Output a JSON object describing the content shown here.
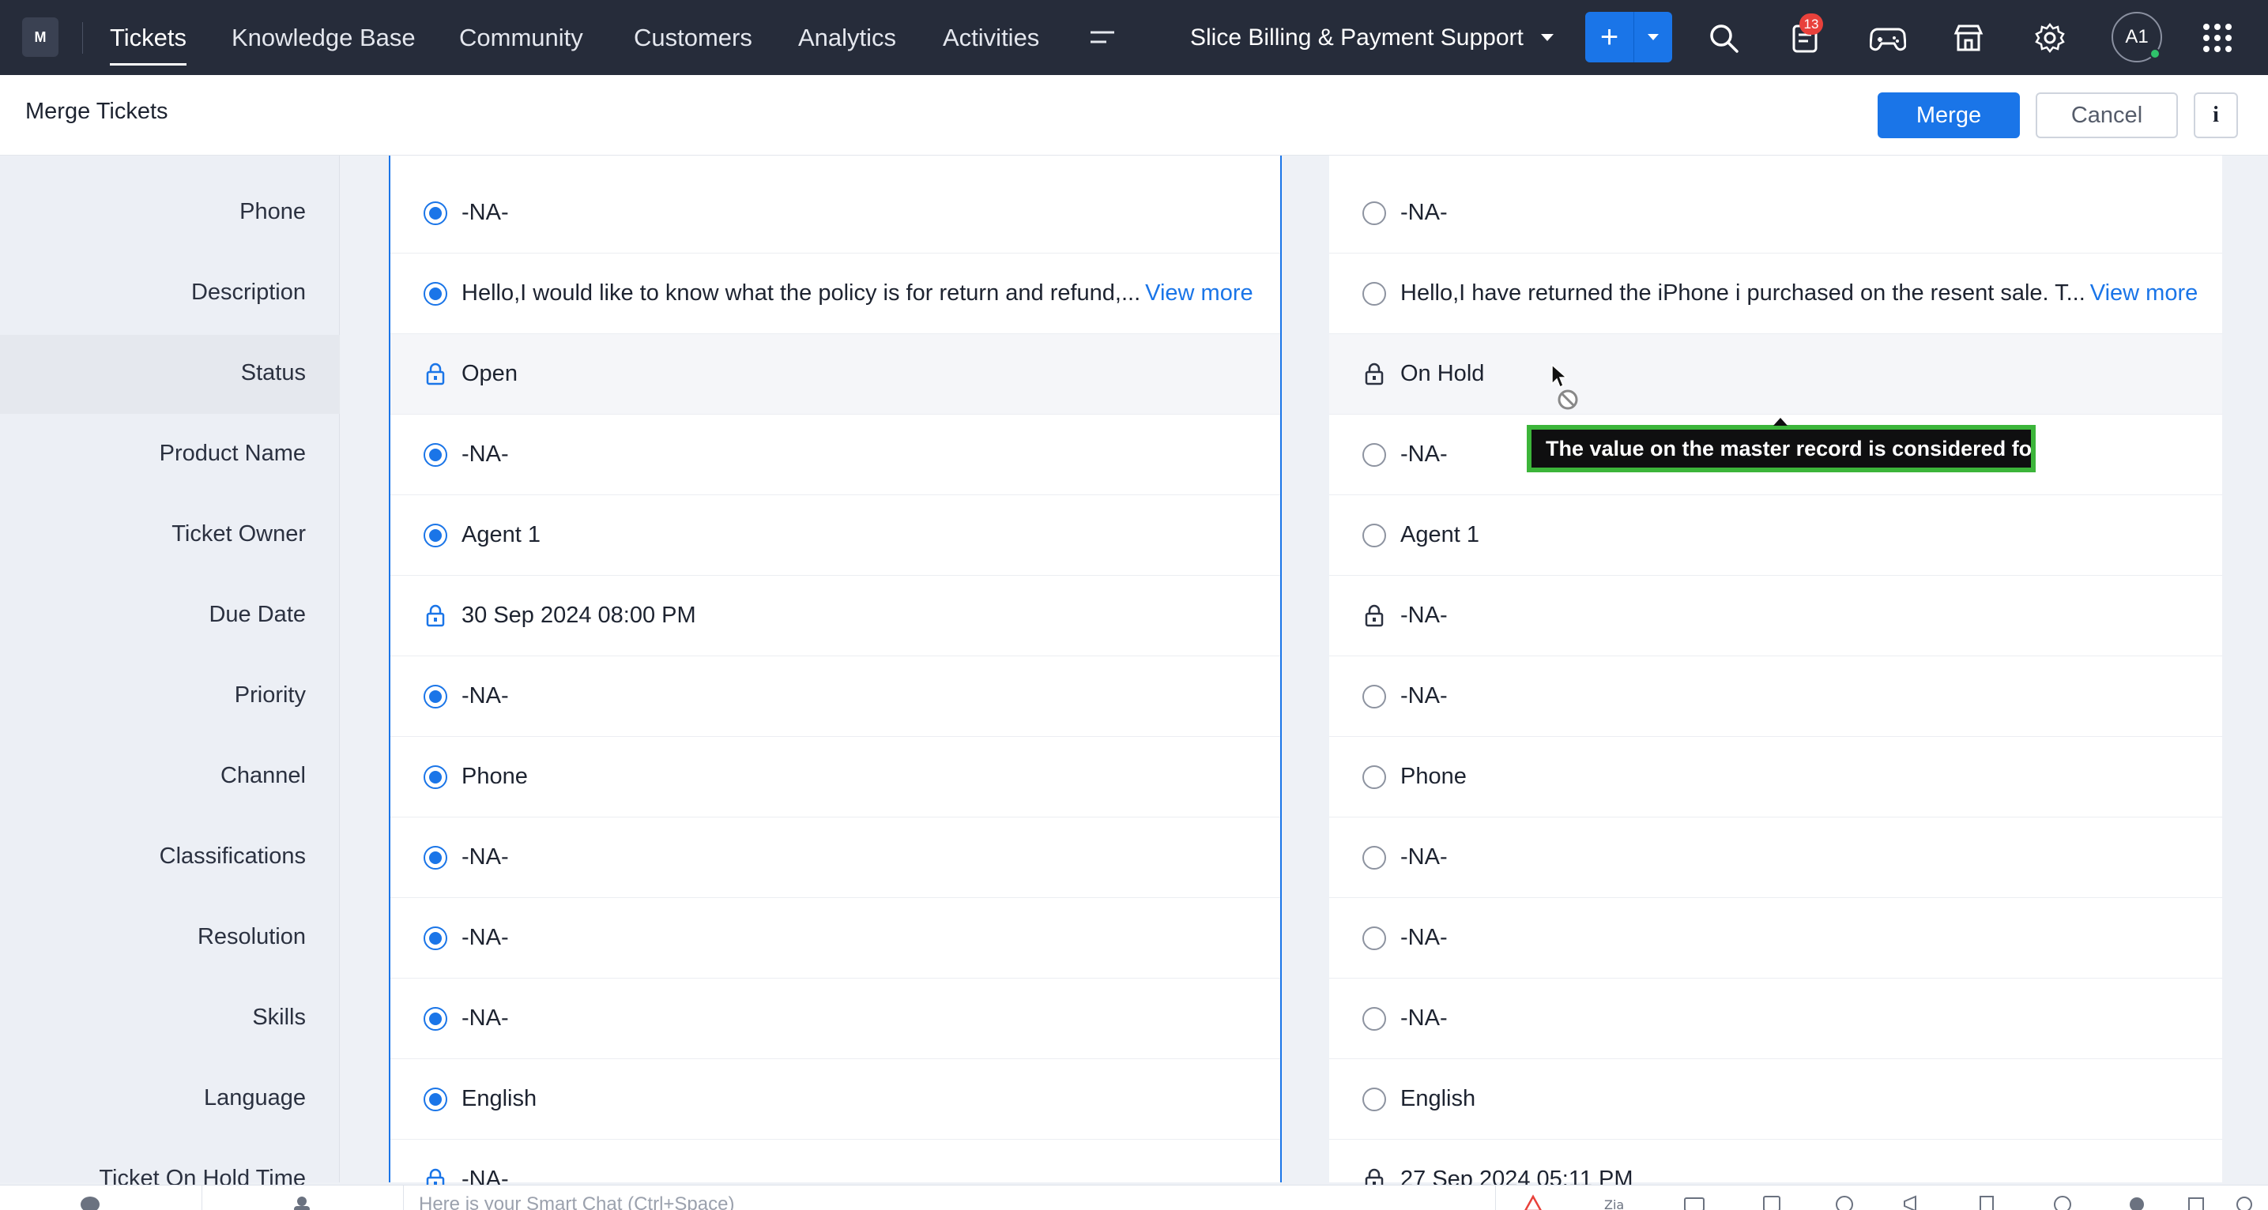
{
  "app": {
    "logo_text": "M",
    "nav_tabs": [
      {
        "label": "Tickets",
        "active": true
      },
      {
        "label": "Knowledge Base"
      },
      {
        "label": "Community"
      },
      {
        "label": "Customers"
      },
      {
        "label": "Analytics"
      },
      {
        "label": "Activities"
      }
    ],
    "department": "Slice Billing & Payment Support",
    "notification_count": "13",
    "avatar_initials": "A1",
    "accent_color": "#1a75e8"
  },
  "header": {
    "title": "Merge Tickets",
    "merge_label": "Merge",
    "cancel_label": "Cancel",
    "info_label": "i"
  },
  "fields": [
    {
      "label": "Phone",
      "master": {
        "type": "radio",
        "value": "-NA-"
      },
      "other": {
        "type": "radio",
        "value": "-NA-"
      }
    },
    {
      "label": "Description",
      "master": {
        "type": "radio",
        "value": "Hello,I would like to know what the policy is for return and refund,...",
        "link": "View more"
      },
      "other": {
        "type": "radio",
        "value": "Hello,I have returned the iPhone i purchased on the resent sale. T...",
        "link": "View more"
      }
    },
    {
      "label": "Status",
      "master": {
        "type": "lock",
        "value": "Open"
      },
      "other": {
        "type": "lock",
        "value": "On Hold"
      }
    },
    {
      "label": "Product Name",
      "master": {
        "type": "radio",
        "value": "-NA-"
      },
      "other": {
        "type": "radio",
        "value": "-NA-"
      }
    },
    {
      "label": "Ticket Owner",
      "master": {
        "type": "radio",
        "value": "Agent 1"
      },
      "other": {
        "type": "radio",
        "value": "Agent 1"
      }
    },
    {
      "label": "Due Date",
      "master": {
        "type": "lock",
        "value": "30 Sep 2024 08:00 PM"
      },
      "other": {
        "type": "lock",
        "value": "-NA-"
      }
    },
    {
      "label": "Priority",
      "master": {
        "type": "radio",
        "value": "-NA-"
      },
      "other": {
        "type": "radio",
        "value": "-NA-"
      }
    },
    {
      "label": "Channel",
      "master": {
        "type": "radio",
        "value": "Phone"
      },
      "other": {
        "type": "radio",
        "value": "Phone"
      }
    },
    {
      "label": "Classifications",
      "master": {
        "type": "radio",
        "value": "-NA-"
      },
      "other": {
        "type": "radio",
        "value": "-NA-"
      }
    },
    {
      "label": "Resolution",
      "master": {
        "type": "radio",
        "value": "-NA-"
      },
      "other": {
        "type": "radio",
        "value": "-NA-"
      }
    },
    {
      "label": "Skills",
      "master": {
        "type": "radio",
        "value": "-NA-"
      },
      "other": {
        "type": "radio",
        "value": "-NA-"
      }
    },
    {
      "label": "Language",
      "master": {
        "type": "radio",
        "value": "English"
      },
      "other": {
        "type": "radio",
        "value": "English"
      }
    },
    {
      "label": "Ticket On Hold Time",
      "master": {
        "type": "lock",
        "value": "-NA-"
      },
      "other": {
        "type": "lock",
        "value": "27 Sep 2024 05:11 PM"
      }
    }
  ],
  "tooltip": {
    "text": "The value on the master record is considered for"
  },
  "bottom_bar": {
    "chat_placeholder": "Here is your Smart Chat (Ctrl+Space)"
  }
}
